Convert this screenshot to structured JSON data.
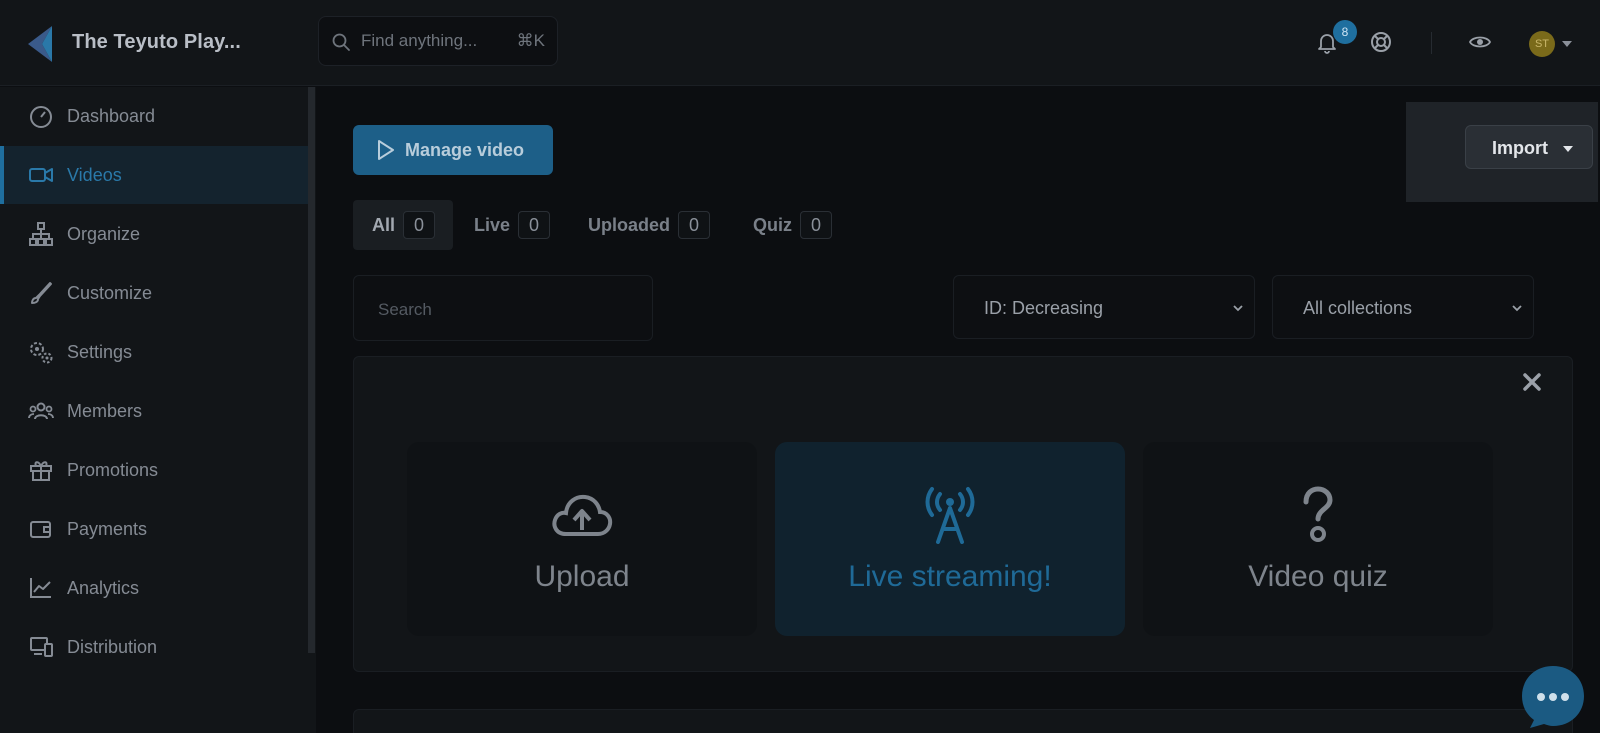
{
  "app": {
    "brand": "The Teyuto Play...",
    "search_placeholder": "Find anything...",
    "search_shortcut": "⌘K",
    "notification_count": "8",
    "avatar_initials": "ST"
  },
  "sidebar": {
    "items": [
      {
        "label": "Dashboard",
        "icon": "dashboard-icon"
      },
      {
        "label": "Videos",
        "icon": "video-camera-icon",
        "active": true
      },
      {
        "label": "Organize",
        "icon": "hierarchy-icon"
      },
      {
        "label": "Customize",
        "icon": "brush-icon"
      },
      {
        "label": "Settings",
        "icon": "gears-icon"
      },
      {
        "label": "Members",
        "icon": "users-icon"
      },
      {
        "label": "Promotions",
        "icon": "gift-icon"
      },
      {
        "label": "Payments",
        "icon": "wallet-icon"
      },
      {
        "label": "Analytics",
        "icon": "chart-icon"
      },
      {
        "label": "Distribution",
        "icon": "devices-icon"
      }
    ]
  },
  "main": {
    "manage_button": "Manage video",
    "import_button": "Import",
    "tabs": [
      {
        "label": "All",
        "count": "0"
      },
      {
        "label": "Live",
        "count": "0"
      },
      {
        "label": "Uploaded",
        "count": "0"
      },
      {
        "label": "Quiz",
        "count": "0"
      }
    ],
    "search_placeholder": "Search",
    "sort_select": "ID: Decreasing",
    "collection_select": "All collections",
    "choices": [
      {
        "label": "Upload",
        "icon": "cloud-upload-icon"
      },
      {
        "label": "Live streaming!",
        "icon": "broadcast-tower-icon"
      },
      {
        "label": "Video quiz",
        "icon": "question-mark-icon"
      }
    ]
  },
  "colors": {
    "accent": "#1f6f9f",
    "background": "#0c0e11",
    "sidebar": "#121518"
  }
}
